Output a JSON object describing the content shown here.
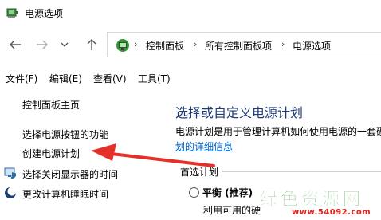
{
  "window": {
    "title": "电源选项"
  },
  "address": {
    "crumbs": [
      "控制面板",
      "所有控制面板项",
      "电源选项"
    ],
    "separator": "›"
  },
  "menu": {
    "items": [
      "文件(F)",
      "编辑(E)",
      "查看(V)",
      "工具(T)"
    ]
  },
  "sidebar": {
    "home": "控制面板主页",
    "links": [
      "选择电源按钮的功能",
      "创建电源计划",
      "选择关闭显示器的时间",
      "更改计算机睡眠时间"
    ]
  },
  "main": {
    "title": "选择或自定义电源计划",
    "desc": "电源计划是用于管理计算机如何使用电源的一套硬",
    "link": "划的详细信息",
    "section": "首选计划",
    "plan_name": "平衡 (推荐)",
    "plan_desc": "利用可用的硬"
  },
  "watermark": {
    "main": "绿色资源网",
    "url": "www.54092.com"
  },
  "colors": {
    "link": "#0066cc",
    "title": "#1e3a78",
    "arrow": "#e5302a",
    "watermark_green": "#2e9b2e",
    "watermark_red": "#e5231b"
  }
}
